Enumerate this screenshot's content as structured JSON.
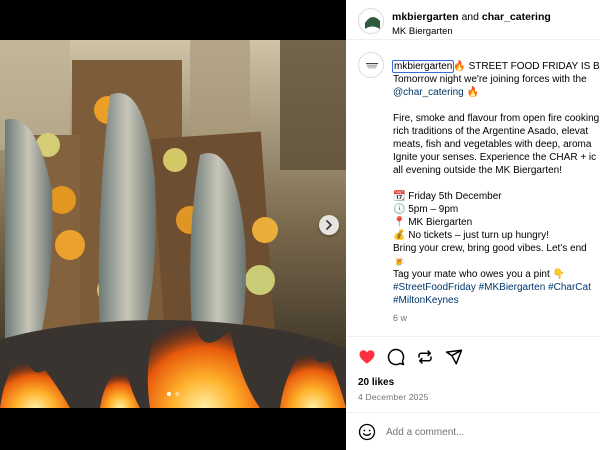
{
  "post": {
    "author": "mkbiergarten",
    "joiner": "and",
    "collaborator": "char_catering",
    "location": "MK Biergarten"
  },
  "caption": {
    "username": "mkbiergarten",
    "first_line_rest": "🔥 STREET FOOD FRIDAY IS BACK",
    "line2": "Tomorrow night we're joining forces with the",
    "mention": "@char_catering 🔥",
    "para2": [
      "Fire, smoke and flavour from open fire cooking",
      "rich traditions of the Argentine Asado, elevat",
      "meats, fish and vegetables with deep, aroma",
      "Ignite your senses. Experience the CHAR + ic",
      "all evening outside the MK Biergarten!"
    ],
    "details": [
      "📆 Friday 5th December",
      "🕔 5pm – 9pm",
      "📍 MK Biergarten",
      "💰 No tickets – just turn up hungry!",
      "Bring your crew, bring good vibes. Let's end",
      "🍺"
    ],
    "tag_line": "Tag your mate who owes you a pint 👇",
    "hashtags_line1": "#StreetFoodFriday #MKBiergarten #CharCat",
    "hashtags_line2": "#MiltonKeynes",
    "time_ago": "6 w"
  },
  "engagement": {
    "likes": "20 likes",
    "date": "4 December 2025"
  },
  "comment": {
    "placeholder": "Add a comment..."
  },
  "icons": {
    "like": "heart-filled-icon",
    "comment": "comment-icon",
    "share": "repost-icon",
    "send": "send-icon",
    "next": "chevron-right-icon",
    "emoji": "emoji-icon"
  },
  "colors": {
    "like_red": "#ff3040",
    "link_blue": "#00376b",
    "meta_gray": "#737373"
  },
  "carousel": {
    "slides": 2,
    "active": 1
  }
}
